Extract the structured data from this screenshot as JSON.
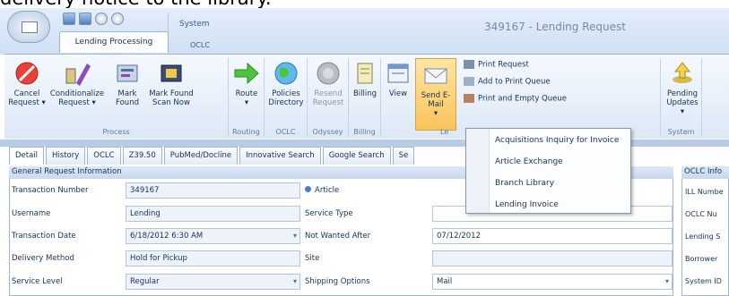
{
  "caption": "delivery notice to the library.",
  "app": {
    "window_title": "349167 - Lending Request"
  },
  "ribbon_tabs": {
    "context_system": "System",
    "context_oclc": "OCLC",
    "active_tab": "Lending Processing",
    "oclc_tab": "OCLC"
  },
  "groups": {
    "process": {
      "label": "Process",
      "buttons": [
        {
          "label1": "Cancel",
          "label2": "Request ▾",
          "icon": "cancel-icon"
        },
        {
          "label1": "Conditionalize",
          "label2": "Request ▾",
          "icon": "pencil-icon"
        },
        {
          "label1": "Mark",
          "label2": "Found",
          "icon": "document-icon"
        },
        {
          "label1": "Mark Found",
          "label2": "Scan Now",
          "icon": "scanner-icon"
        }
      ]
    },
    "routing": {
      "label": "Routing",
      "button1": "Route",
      "button2": "▾",
      "icon": "arrow-right-icon"
    },
    "oclc": {
      "label": "OCLC",
      "button1": "Policies",
      "button2": "Directory",
      "icon": "globe-icon"
    },
    "odyssey": {
      "label": "Odyssey",
      "button1": "Resend",
      "button2": "Request",
      "icon": "odyssey-icon"
    },
    "billing": {
      "label": "Billing",
      "button1": "Billing",
      "icon": "billing-icon"
    },
    "letters": {
      "label": "Le",
      "view": "View",
      "send_email": "Send E-Mail",
      "send_email_arrow": "▾",
      "print_request": "Print Request",
      "add_to_print_queue": "Add to Print Queue",
      "print_and_empty_queue": "Print and Empty Queue"
    },
    "system": {
      "label": "System",
      "button1": "Pending",
      "button2": "Updates ▾",
      "icon": "pending-updates-icon"
    }
  },
  "detail_tabs": [
    "Detail",
    "History",
    "OCLC",
    "Z39.50",
    "PubMed/Docline",
    "Innovative Search",
    "Google Search",
    "Se"
  ],
  "email_menu": {
    "items": [
      "Acquisitions Inquiry for Invoice",
      "Article Exchange",
      "Branch Library",
      "Lending Invoice"
    ]
  },
  "form": {
    "section_title": "General Request Information",
    "transaction_number_label": "Transaction Number",
    "transaction_number": "349167",
    "article_option": "Article",
    "username_label": "Username",
    "username": "Lending",
    "service_type_label": "Service Type",
    "service_type": "",
    "transaction_date_label": "Transaction Date",
    "transaction_date": "6/18/2012 6:30 AM",
    "not_wanted_after_label": "Not Wanted After",
    "not_wanted_after": "07/12/2012",
    "delivery_method_label": "Delivery Method",
    "delivery_method": "Hold for Pickup",
    "site_label": "Site",
    "site": "",
    "service_level_label": "Service Level",
    "service_level": "Regular",
    "shipping_options_label": "Shipping Options",
    "shipping_options": "Mail"
  },
  "right_panel": {
    "title": "OCLC Info",
    "labels": [
      "ILL Numbe",
      "OCLC Nu",
      "Lending S",
      "Borrower",
      "System ID"
    ]
  },
  "colors": {
    "accent": "#f9c35b",
    "ribbon": "#dde8f6",
    "text": "#15315a"
  }
}
